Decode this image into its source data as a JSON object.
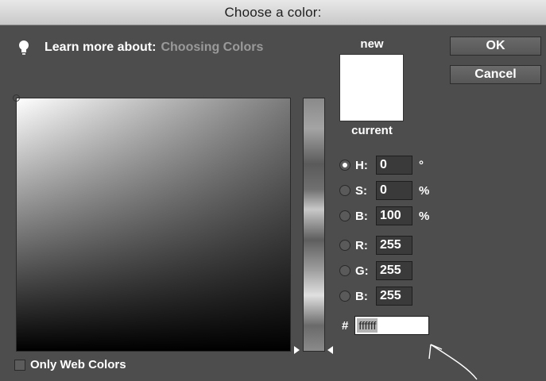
{
  "window": {
    "title": "Choose a color:"
  },
  "learn": {
    "label": "Learn more about:",
    "link": "Choosing Colors",
    "icon": "lightbulb-icon"
  },
  "preview": {
    "new_label": "new",
    "current_label": "current",
    "new_color": "#ffffff"
  },
  "buttons": {
    "ok": "OK",
    "cancel": "Cancel"
  },
  "fields": {
    "h": {
      "label": "H:",
      "value": "0",
      "unit": "°",
      "selected": true
    },
    "s": {
      "label": "S:",
      "value": "0",
      "unit": "%",
      "selected": false
    },
    "b": {
      "label": "B:",
      "value": "100",
      "unit": "%",
      "selected": false
    },
    "r": {
      "label": "R:",
      "value": "255",
      "selected": false
    },
    "g": {
      "label": "G:",
      "value": "255",
      "selected": false
    },
    "b2": {
      "label": "B:",
      "value": "255",
      "selected": false
    }
  },
  "hex": {
    "prefix": "#",
    "value": "ffffff"
  },
  "web_colors": {
    "label": "Only Web Colors",
    "checked": false
  }
}
